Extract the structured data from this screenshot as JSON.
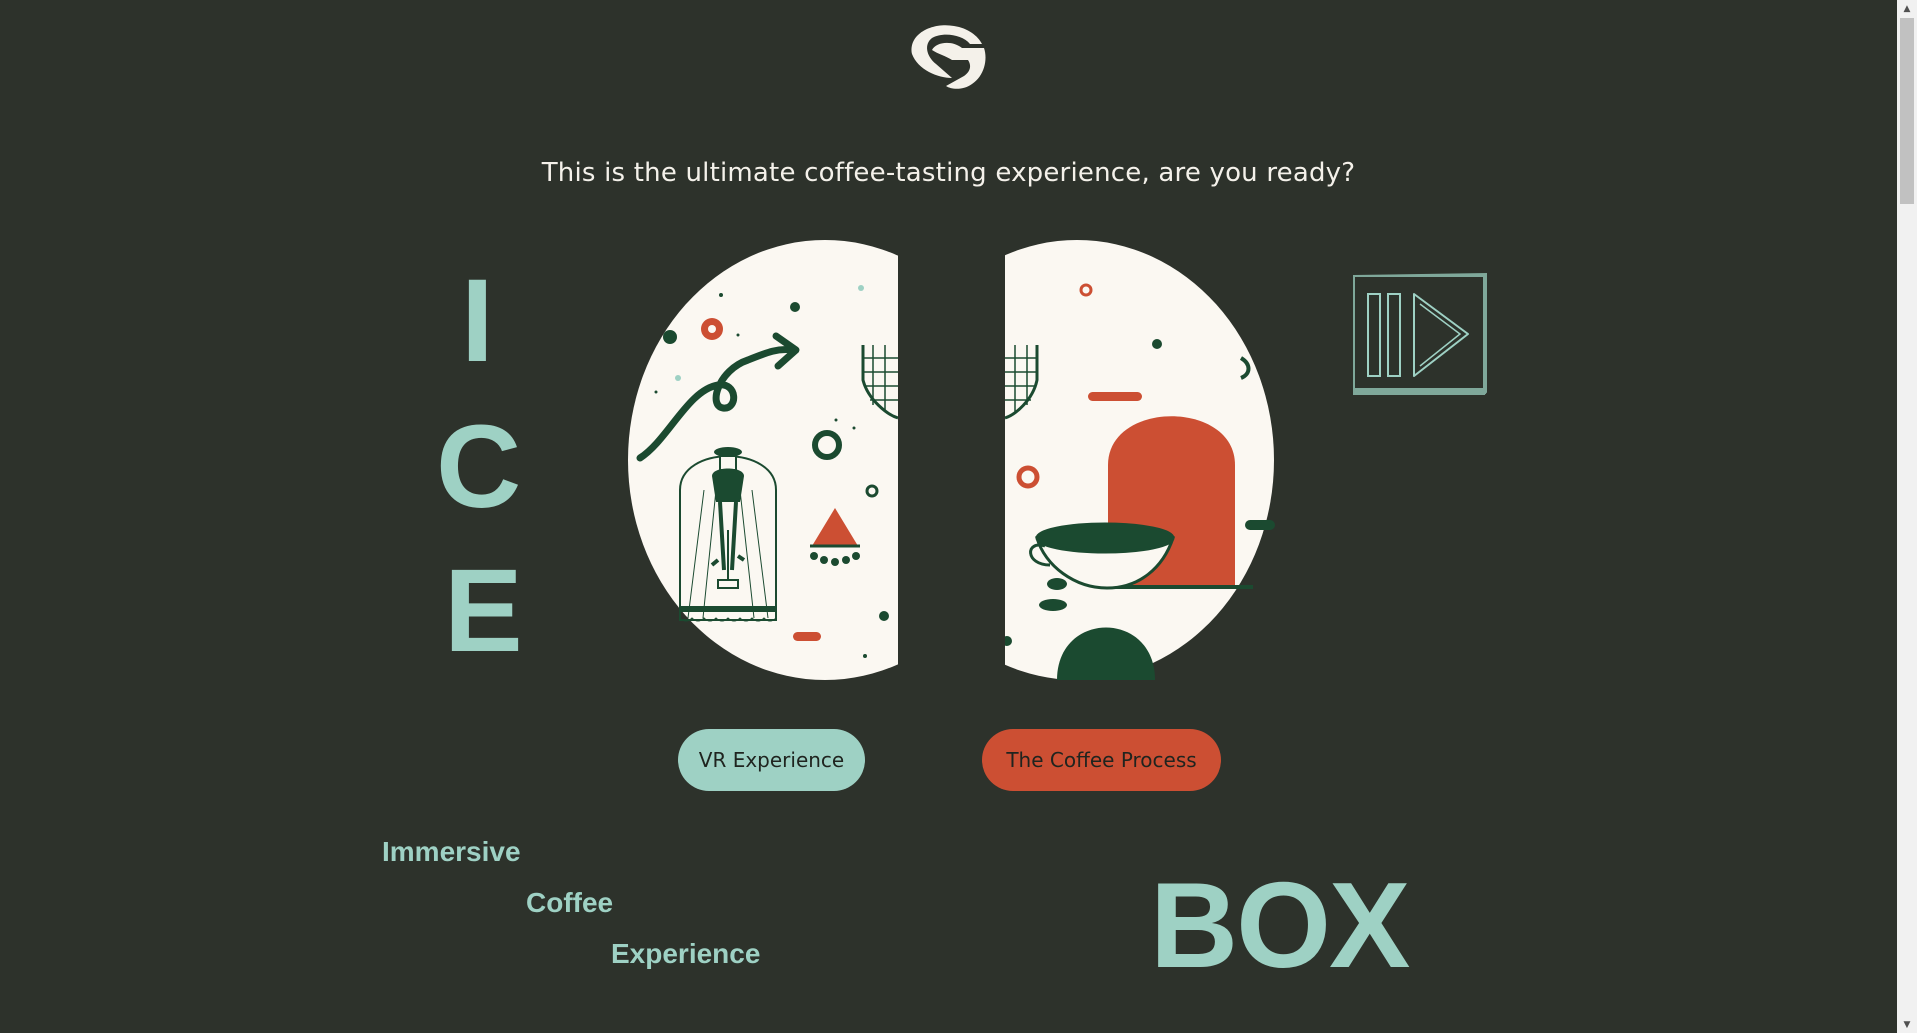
{
  "tagline": "This is the ultimate coffee-tasting experience, are you ready?",
  "vertical_letters": [
    "I",
    "C",
    "E"
  ],
  "buttons": {
    "vr": "VR Experience",
    "process": "The Coffee Process"
  },
  "words": {
    "immersive": "Immersive",
    "coffee": "Coffee",
    "experience": "Experience"
  },
  "box": "BOX",
  "colors": {
    "background": "#2d322b",
    "mint": "#9ed1c4",
    "orange": "#cc4f33",
    "cream": "#fbf8f2",
    "dark_green": "#1b4a30"
  },
  "icons": {
    "logo": "brand-logo",
    "play": "play-icon",
    "scroll_up": "scroll-up-arrow",
    "scroll_down": "scroll-down-arrow"
  }
}
